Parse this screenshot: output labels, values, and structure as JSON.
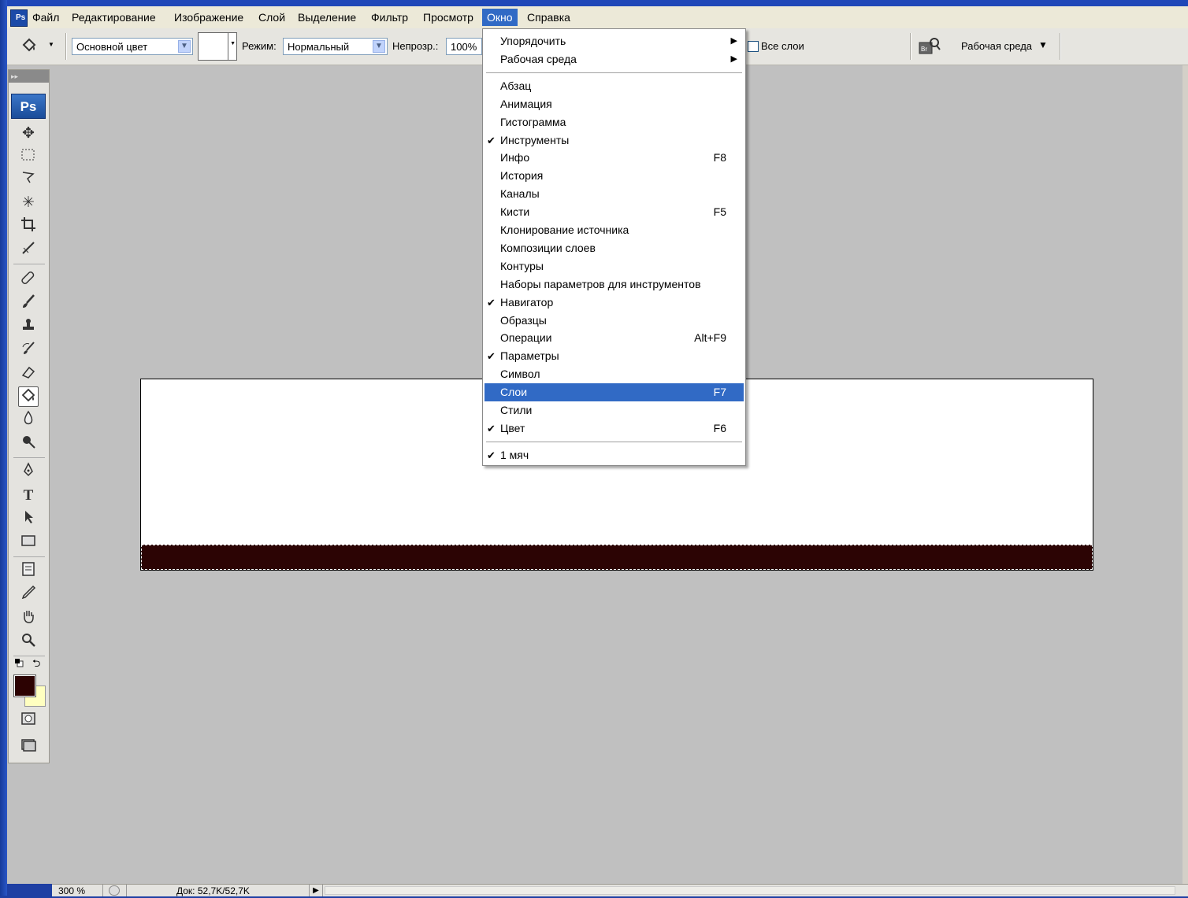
{
  "menubar": {
    "items": [
      "Файл",
      "Редактирование",
      "Изображение",
      "Слой",
      "Выделение",
      "Фильтр",
      "Просмотр",
      "Окно",
      "Справка"
    ],
    "active_index": 7
  },
  "options": {
    "fill_source": "Основной цвет",
    "mode_label": "Режим:",
    "mode_value": "Нормальный",
    "opacity_label": "Непрозр.:",
    "opacity_value": "100%",
    "all_layers_label": "Все слои",
    "workspace_label": "Рабочая среда"
  },
  "window_menu": {
    "group1": [
      {
        "label": "Упорядочить",
        "submenu": true
      },
      {
        "label": "Рабочая среда",
        "submenu": true
      }
    ],
    "group2": [
      {
        "label": "Абзац",
        "checked": false,
        "shortcut": ""
      },
      {
        "label": "Анимация",
        "checked": false,
        "shortcut": ""
      },
      {
        "label": "Гистограмма",
        "checked": false,
        "shortcut": ""
      },
      {
        "label": "Инструменты",
        "checked": true,
        "shortcut": ""
      },
      {
        "label": "Инфо",
        "checked": false,
        "shortcut": "F8"
      },
      {
        "label": "История",
        "checked": false,
        "shortcut": ""
      },
      {
        "label": "Каналы",
        "checked": false,
        "shortcut": ""
      },
      {
        "label": "Кисти",
        "checked": false,
        "shortcut": "F5"
      },
      {
        "label": "Клонирование источника",
        "checked": false,
        "shortcut": ""
      },
      {
        "label": "Композиции слоев",
        "checked": false,
        "shortcut": ""
      },
      {
        "label": "Контуры",
        "checked": false,
        "shortcut": ""
      },
      {
        "label": "Наборы параметров для инструментов",
        "checked": false,
        "shortcut": ""
      },
      {
        "label": "Навигатор",
        "checked": true,
        "shortcut": ""
      },
      {
        "label": "Образцы",
        "checked": false,
        "shortcut": ""
      },
      {
        "label": "Операции",
        "checked": false,
        "shortcut": "Alt+F9"
      },
      {
        "label": "Параметры",
        "checked": true,
        "shortcut": ""
      },
      {
        "label": "Символ",
        "checked": false,
        "shortcut": ""
      },
      {
        "label": "Слои",
        "checked": false,
        "shortcut": "F7",
        "highlighted": true
      },
      {
        "label": "Стили",
        "checked": false,
        "shortcut": ""
      },
      {
        "label": "Цвет",
        "checked": true,
        "shortcut": "F6"
      }
    ],
    "group3": [
      {
        "label": "1 мяч",
        "checked": true,
        "shortcut": ""
      }
    ]
  },
  "toolbox": {
    "badge": "Ps",
    "foreground_color": "#2c0202",
    "background_color": "#ffffc0"
  },
  "canvas": {
    "band_color": "#2c0404"
  },
  "status": {
    "zoom": "300 %",
    "doc_info": "Док: 52,7K/52,7K"
  },
  "icons": {
    "check": "✔",
    "submenu": "▶",
    "dropdown": "▼"
  }
}
